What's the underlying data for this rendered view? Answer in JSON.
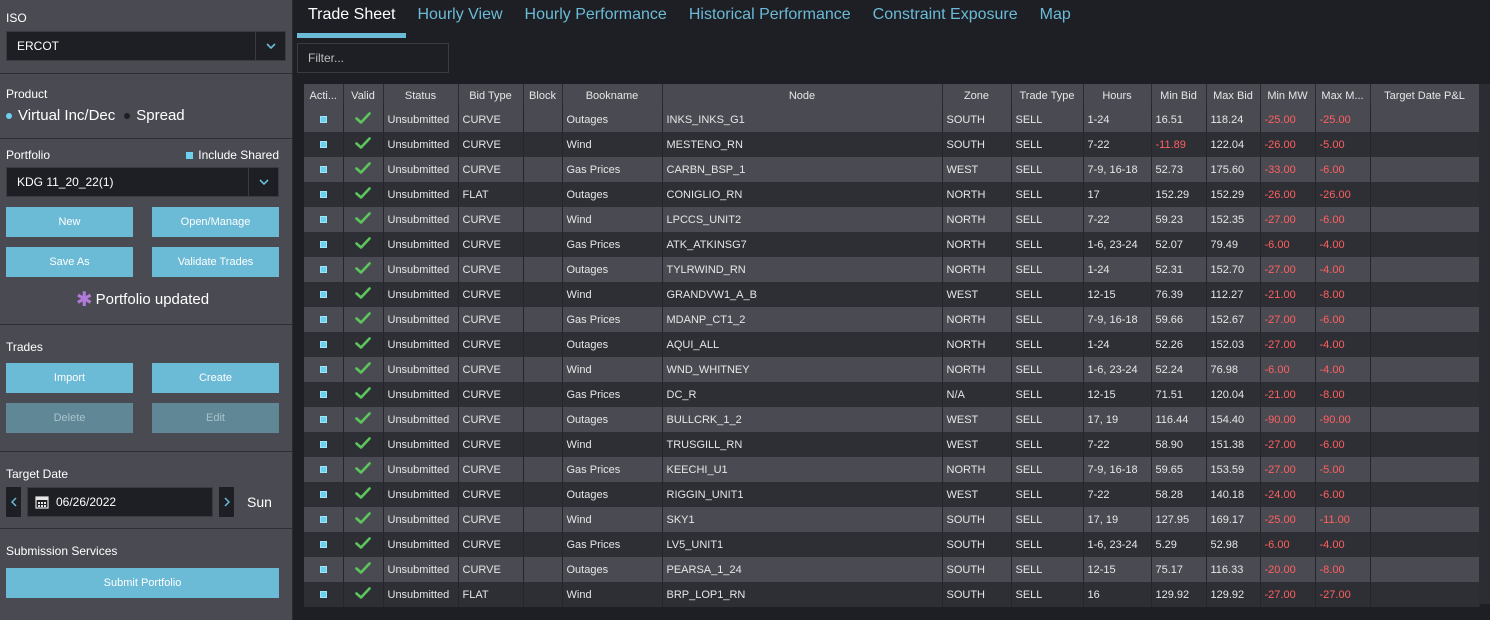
{
  "sidebar": {
    "iso": {
      "label": "ISO",
      "value": "ERCOT"
    },
    "product": {
      "label": "Product",
      "option1": "Virtual Inc/Dec",
      "option2": "Spread"
    },
    "portfolio": {
      "label": "Portfolio",
      "include_shared": "Include Shared",
      "value": "KDG 11_20_22(1)"
    },
    "buttons": {
      "new": "New",
      "open_manage": "Open/Manage",
      "save_as": "Save As",
      "validate": "Validate Trades"
    },
    "status": "Portfolio updated",
    "trades": {
      "label": "Trades",
      "import": "Import",
      "create": "Create",
      "delete": "Delete",
      "edit": "Edit"
    },
    "target_date": {
      "label": "Target Date",
      "value": "06/26/2022",
      "day": "Sun"
    },
    "submission": {
      "label": "Submission Services",
      "submit": "Submit Portfolio"
    }
  },
  "tabs": [
    "Trade Sheet",
    "Hourly View",
    "Hourly Performance",
    "Historical Performance",
    "Constraint Exposure",
    "Map"
  ],
  "filter_placeholder": "Filter...",
  "columns": [
    "Acti...",
    "Valid",
    "Status",
    "Bid Type",
    "Block",
    "Bookname",
    "Node",
    "Zone",
    "Trade Type",
    "Hours",
    "Min Bid",
    "Max Bid",
    "Min MW",
    "Max M...",
    "Target Date P&L"
  ],
  "rows": [
    [
      "Unsubmitted",
      "CURVE",
      "",
      "Outages",
      "INKS_INKS_G1",
      "SOUTH",
      "SELL",
      "1-24",
      "16.51",
      "118.24",
      "-25.00",
      "-25.00"
    ],
    [
      "Unsubmitted",
      "CURVE",
      "",
      "Wind",
      "MESTENO_RN",
      "SOUTH",
      "SELL",
      "7-22",
      "-11.89",
      "122.04",
      "-26.00",
      "-5.00"
    ],
    [
      "Unsubmitted",
      "CURVE",
      "",
      "Gas Prices",
      "CARBN_BSP_1",
      "WEST",
      "SELL",
      "7-9, 16-18",
      "52.73",
      "175.60",
      "-33.00",
      "-6.00"
    ],
    [
      "Unsubmitted",
      "FLAT",
      "",
      "Outages",
      "CONIGLIO_RN",
      "NORTH",
      "SELL",
      "17",
      "152.29",
      "152.29",
      "-26.00",
      "-26.00"
    ],
    [
      "Unsubmitted",
      "CURVE",
      "",
      "Wind",
      "LPCCS_UNIT2",
      "NORTH",
      "SELL",
      "7-22",
      "59.23",
      "152.35",
      "-27.00",
      "-6.00"
    ],
    [
      "Unsubmitted",
      "CURVE",
      "",
      "Gas Prices",
      "ATK_ATKINSG7",
      "NORTH",
      "SELL",
      "1-6, 23-24",
      "52.07",
      "79.49",
      "-6.00",
      "-4.00"
    ],
    [
      "Unsubmitted",
      "CURVE",
      "",
      "Outages",
      "TYLRWIND_RN",
      "NORTH",
      "SELL",
      "1-24",
      "52.31",
      "152.70",
      "-27.00",
      "-4.00"
    ],
    [
      "Unsubmitted",
      "CURVE",
      "",
      "Wind",
      "GRANDVW1_A_B",
      "WEST",
      "SELL",
      "12-15",
      "76.39",
      "112.27",
      "-21.00",
      "-8.00"
    ],
    [
      "Unsubmitted",
      "CURVE",
      "",
      "Gas Prices",
      "MDANP_CT1_2",
      "NORTH",
      "SELL",
      "7-9, 16-18",
      "59.66",
      "152.67",
      "-27.00",
      "-6.00"
    ],
    [
      "Unsubmitted",
      "CURVE",
      "",
      "Outages",
      "AQUI_ALL",
      "NORTH",
      "SELL",
      "1-24",
      "52.26",
      "152.03",
      "-27.00",
      "-4.00"
    ],
    [
      "Unsubmitted",
      "CURVE",
      "",
      "Wind",
      "WND_WHITNEY",
      "NORTH",
      "SELL",
      "1-6, 23-24",
      "52.24",
      "76.98",
      "-6.00",
      "-4.00"
    ],
    [
      "Unsubmitted",
      "CURVE",
      "",
      "Gas Prices",
      "DC_R",
      "N/A",
      "SELL",
      "12-15",
      "71.51",
      "120.04",
      "-21.00",
      "-8.00"
    ],
    [
      "Unsubmitted",
      "CURVE",
      "",
      "Outages",
      "BULLCRK_1_2",
      "WEST",
      "SELL",
      "17, 19",
      "116.44",
      "154.40",
      "-90.00",
      "-90.00"
    ],
    [
      "Unsubmitted",
      "CURVE",
      "",
      "Wind",
      "TRUSGILL_RN",
      "WEST",
      "SELL",
      "7-22",
      "58.90",
      "151.38",
      "-27.00",
      "-6.00"
    ],
    [
      "Unsubmitted",
      "CURVE",
      "",
      "Gas Prices",
      "KEECHI_U1",
      "NORTH",
      "SELL",
      "7-9, 16-18",
      "59.65",
      "153.59",
      "-27.00",
      "-5.00"
    ],
    [
      "Unsubmitted",
      "CURVE",
      "",
      "Outages",
      "RIGGIN_UNIT1",
      "WEST",
      "SELL",
      "7-22",
      "58.28",
      "140.18",
      "-24.00",
      "-6.00"
    ],
    [
      "Unsubmitted",
      "CURVE",
      "",
      "Wind",
      "SKY1",
      "SOUTH",
      "SELL",
      "17, 19",
      "127.95",
      "169.17",
      "-25.00",
      "-11.00"
    ],
    [
      "Unsubmitted",
      "CURVE",
      "",
      "Gas Prices",
      "LV5_UNIT1",
      "SOUTH",
      "SELL",
      "1-6, 23-24",
      "5.29",
      "52.98",
      "-6.00",
      "-4.00"
    ],
    [
      "Unsubmitted",
      "CURVE",
      "",
      "Outages",
      "PEARSA_1_24",
      "SOUTH",
      "SELL",
      "12-15",
      "75.17",
      "116.33",
      "-20.00",
      "-8.00"
    ],
    [
      "Unsubmitted",
      "FLAT",
      "",
      "Wind",
      "BRP_LOP1_RN",
      "SOUTH",
      "SELL",
      "16",
      "129.92",
      "129.92",
      "-27.00",
      "-27.00"
    ]
  ]
}
